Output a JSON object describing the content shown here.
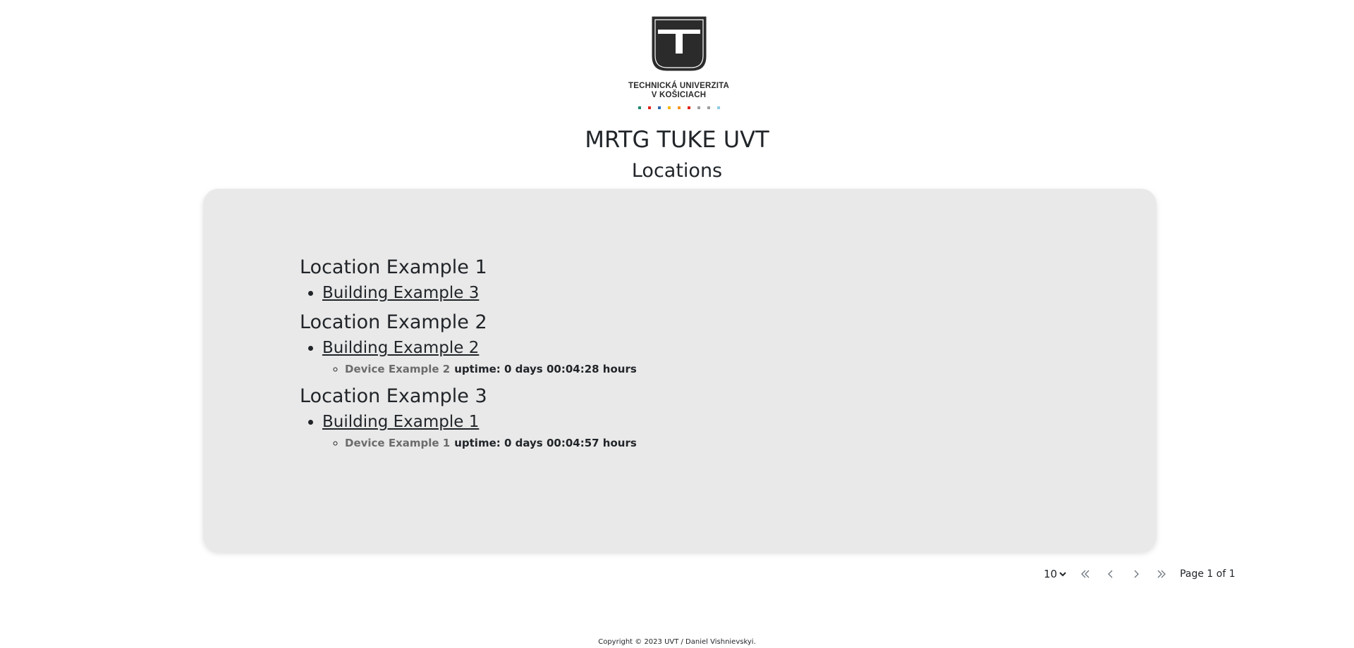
{
  "logo": {
    "line1": "TECHNICKÁ UNIVERZITA",
    "line2": "V KOŠICIACH",
    "dot_colors": [
      "#1e8a6e",
      "#e2231a",
      "#2b6bb2",
      "#f5b400",
      "#f7931e",
      "#e2231a",
      "#9e9e9e",
      "#9e9e9e",
      "#8fcbe3"
    ]
  },
  "header": {
    "site_title": "MRTG TUKE UVT",
    "page_title": "Locations"
  },
  "locations": [
    {
      "name": "Location Example 1",
      "buildings": [
        {
          "name": "Building Example 3",
          "devices": []
        }
      ]
    },
    {
      "name": "Location Example 2",
      "buildings": [
        {
          "name": "Building Example 2",
          "devices": [
            {
              "name": "Device Example 2",
              "uptime": "uptime: 0 days 00:04:28 hours"
            }
          ]
        }
      ]
    },
    {
      "name": "Location Example 3",
      "buildings": [
        {
          "name": "Building Example 1",
          "devices": [
            {
              "name": "Device Example 1",
              "uptime": "uptime: 0 days 00:04:57 hours"
            }
          ]
        }
      ]
    }
  ],
  "pagination": {
    "page_size": "10",
    "page_info": "Page 1 of 1"
  },
  "footer": {
    "copyright": "Copyright © 2023 UVT / Daniel Vishnievskyi."
  }
}
